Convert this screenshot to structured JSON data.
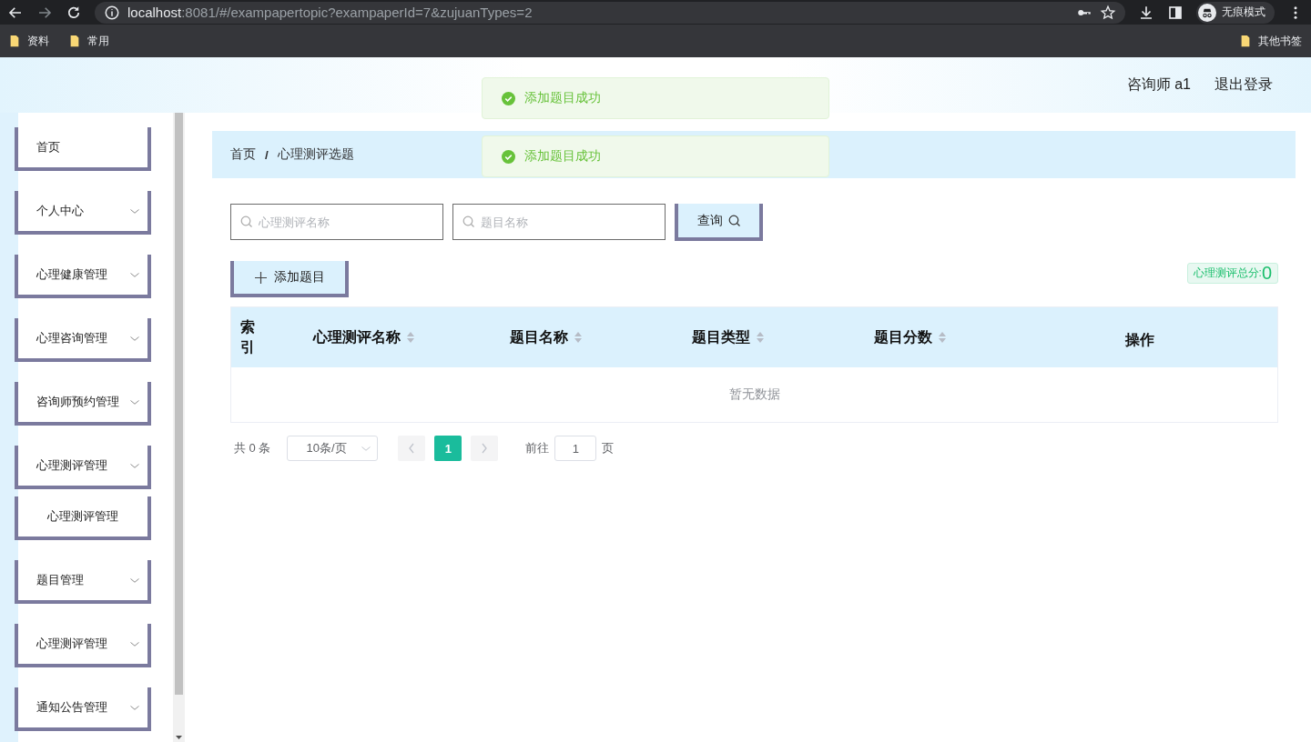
{
  "browser": {
    "url_host": "localhost",
    "url_rest": ":8081/#/exampapertopic?exampaperId=7&zujuanTypes=2",
    "incognito_label": "无痕模式",
    "bookmarks": [
      {
        "label": "资料"
      },
      {
        "label": "常用"
      }
    ],
    "other_bookmarks": "其他书签"
  },
  "header": {
    "user": "咨询师 a1",
    "logout": "退出登录"
  },
  "toasts": [
    {
      "message": "添加题目成功"
    },
    {
      "message": "添加题目成功"
    }
  ],
  "sidebar": {
    "items": [
      {
        "label": "首页",
        "kind": "link"
      },
      {
        "label": "个人中心",
        "kind": "submenu"
      },
      {
        "label": "心理健康管理",
        "kind": "submenu"
      },
      {
        "label": "心理咨询管理",
        "kind": "submenu"
      },
      {
        "label": "咨询师预约管理",
        "kind": "submenu"
      },
      {
        "label": "心理测评管理",
        "kind": "submenu",
        "children": [
          {
            "label": "心理测评管理"
          }
        ]
      },
      {
        "label": "题目管理",
        "kind": "submenu"
      },
      {
        "label": "心理测评管理",
        "kind": "submenu"
      },
      {
        "label": "通知公告管理",
        "kind": "submenu"
      }
    ]
  },
  "breadcrumb": [
    {
      "label": "首页"
    },
    {
      "label": "心理测评选题"
    }
  ],
  "breadcrumb_separator": "/",
  "search": {
    "fields": [
      {
        "placeholder": "心理测评名称"
      },
      {
        "placeholder": "题目名称"
      }
    ],
    "button": "查询"
  },
  "add_button": "添加题目",
  "total_score": {
    "label": "心理测评总分:",
    "value": "0"
  },
  "table": {
    "columns": [
      {
        "label": "索引",
        "sortable": false
      },
      {
        "label": "心理测评名称",
        "sortable": true
      },
      {
        "label": "题目名称",
        "sortable": true
      },
      {
        "label": "题目类型",
        "sortable": true
      },
      {
        "label": "题目分数",
        "sortable": true
      },
      {
        "label": "操作",
        "sortable": false
      }
    ],
    "empty_text": "暂无数据"
  },
  "pagination": {
    "total": "共 0 条",
    "page_size": "10条/页",
    "pages": [
      {
        "label": "1",
        "selected": true
      }
    ],
    "goto_label": "前往",
    "goto_value": "1",
    "page_suffix": "页"
  }
}
